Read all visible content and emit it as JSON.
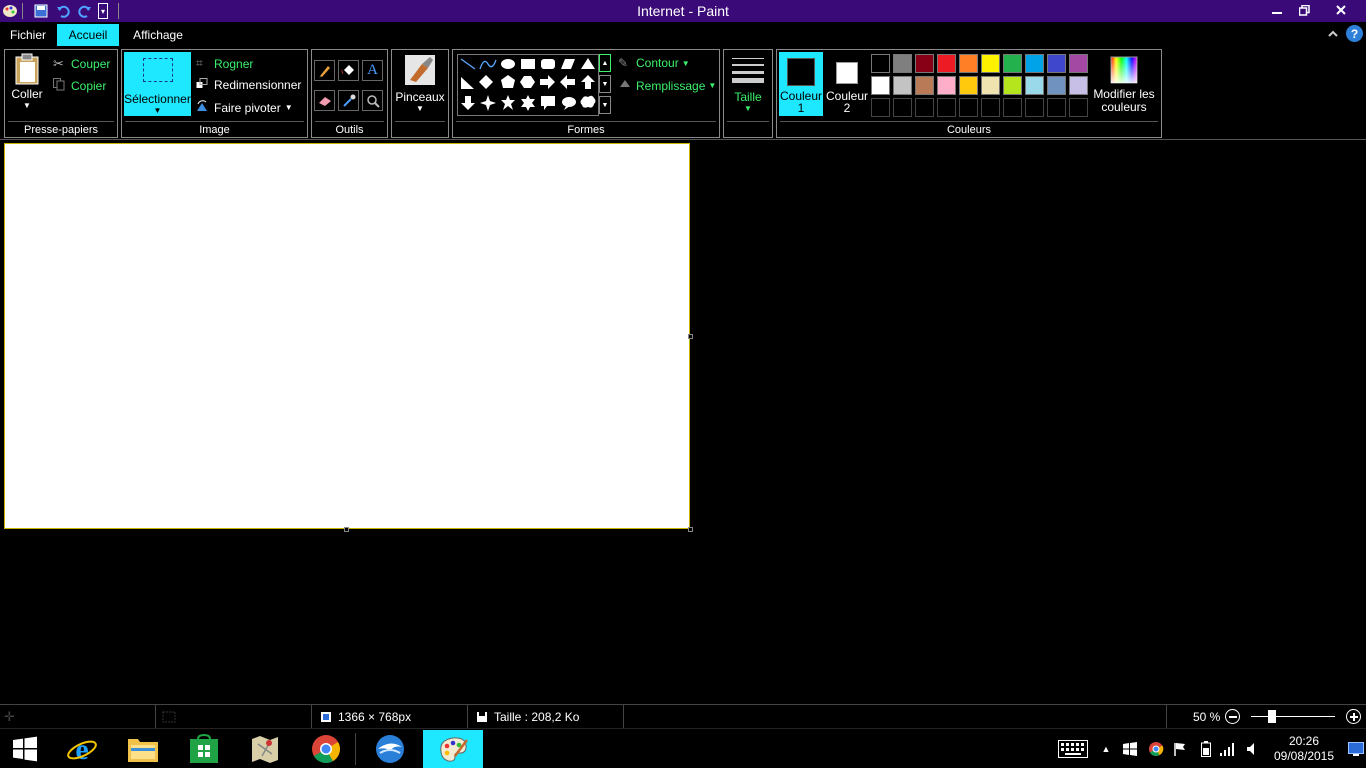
{
  "window": {
    "title": "Internet - Paint"
  },
  "tabs": [
    {
      "label": "Fichier"
    },
    {
      "label": "Accueil"
    },
    {
      "label": "Affichage"
    }
  ],
  "ribbon": {
    "clipboard": {
      "group_label": "Presse-papiers",
      "paste_label": "Coller",
      "cut_label": "Couper",
      "copy_label": "Copier"
    },
    "image": {
      "group_label": "Image",
      "select_label": "Sélectionner",
      "crop_label": "Rogner",
      "resize_label": "Redimensionner",
      "rotate_label": "Faire pivoter"
    },
    "tools": {
      "group_label": "Outils"
    },
    "brushes": {
      "label": "Pinceaux"
    },
    "shapes": {
      "group_label": "Formes",
      "outline_label": "Contour",
      "fill_label": "Remplissage"
    },
    "size": {
      "label": "Taille"
    },
    "colors": {
      "group_label": "Couleurs",
      "color1_label": "Couleur 1",
      "color1_line1": "Couleur",
      "color1_line2": "1",
      "color2_line1": "Couleur",
      "color2_line2": "2",
      "edit_line1": "Modifier les",
      "edit_line2": "couleurs",
      "color1_value": "#000000",
      "color2_value": "#ffffff",
      "palette_row1": [
        "#000000",
        "#7f7f7f",
        "#880015",
        "#ed1c24",
        "#ff7f27",
        "#fff200",
        "#22b14c",
        "#00a2e8",
        "#3f48cc",
        "#a349a4"
      ],
      "palette_row2": [
        "#ffffff",
        "#c3c3c3",
        "#b97a57",
        "#ffaec9",
        "#ffc90e",
        "#efe4b0",
        "#b5e61d",
        "#99d9ea",
        "#7092be",
        "#c8bfe7"
      ]
    }
  },
  "statusbar": {
    "dimensions": "1366 × 768px",
    "size": "Taille : 208,2 Ko",
    "zoom": "50 %",
    "zoom_percent": 50
  },
  "taskbar": {
    "time": "20:26",
    "date": "09/08/2015"
  }
}
